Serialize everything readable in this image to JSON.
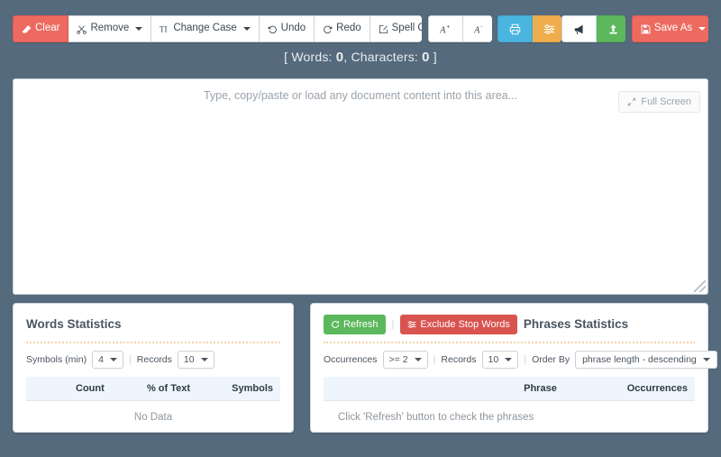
{
  "toolbar": {
    "left_groups": [
      [
        {
          "id": "clear",
          "label": "Clear",
          "icon": "eraser-icon",
          "style": "red",
          "caret": false
        },
        {
          "id": "remove",
          "label": "Remove",
          "icon": "scissors-icon",
          "style": "white",
          "caret": true
        },
        {
          "id": "change-case",
          "label": "Change Case",
          "icon": "text-case-icon",
          "style": "white",
          "caret": true
        },
        {
          "id": "undo",
          "label": "Undo",
          "icon": "undo-icon",
          "style": "white",
          "caret": false
        },
        {
          "id": "redo",
          "label": "Redo",
          "icon": "redo-icon",
          "style": "white",
          "caret": false
        },
        {
          "id": "spell-check",
          "label": "Spell Check",
          "icon": "pencil-square-icon",
          "style": "white",
          "caret": false
        }
      ],
      [
        {
          "id": "font-increase",
          "label": "A",
          "sup": "+",
          "icon": "font-increase-icon",
          "style": "white",
          "caret": false
        },
        {
          "id": "font-decrease",
          "label": "A",
          "sup": "-",
          "icon": "font-decrease-icon",
          "style": "white",
          "caret": false
        }
      ],
      [
        {
          "id": "print",
          "label": "",
          "icon": "print-icon",
          "style": "blue",
          "caret": false
        },
        {
          "id": "format",
          "label": "",
          "icon": "sliders-icon",
          "style": "orange",
          "caret": false
        }
      ]
    ],
    "right_groups": [
      [
        {
          "id": "announce",
          "label": "",
          "icon": "megaphone-icon",
          "style": "white",
          "caret": false
        },
        {
          "id": "upload",
          "label": "",
          "icon": "upload-icon",
          "style": "green",
          "caret": false
        }
      ],
      [
        {
          "id": "save-as",
          "label": "Save As",
          "icon": "save-icon",
          "style": "red",
          "caret": true
        }
      ]
    ]
  },
  "counter": {
    "open_bracket": "[ ",
    "words_label": "Words: ",
    "words_value": "0",
    "mid": ", ",
    "characters_label": "Characters: ",
    "characters_value": "0",
    "close_bracket": " ]"
  },
  "editor": {
    "placeholder": "Type, copy/paste or load any document content into this area...",
    "value": "",
    "fullscreen_label": "Full Screen",
    "fullscreen_icon": "expand-arrows-icon"
  },
  "words_panel": {
    "title": "Words Statistics",
    "controls": {
      "symbols_label": "Symbols (min)",
      "symbols_value": "4",
      "separator": "|",
      "records_label": "Records",
      "records_value": "10"
    },
    "table": {
      "columns": [
        "",
        "Count",
        "% of Text",
        "Symbols"
      ],
      "rows": [],
      "empty_message": "No Data"
    }
  },
  "phrases_panel": {
    "title": "Phrases Statistics",
    "refresh_label": "Refresh",
    "refresh_icon": "refresh-icon",
    "exclude_label": "Exclude Stop Words",
    "exclude_icon": "filter-icon",
    "separator": "|",
    "controls": {
      "occurrences_label": "Occurrences",
      "occurrences_value": ">= 2",
      "records_label": "Records",
      "records_value": "10",
      "order_by_label": "Order By",
      "order_by_value": "phrase length - descending"
    },
    "table": {
      "columns": [
        "",
        "Phrase",
        "Occurrences"
      ],
      "rows": [],
      "empty_message": "Click 'Refresh' button to check the phrases"
    }
  },
  "colors": {
    "background": "#556a7d",
    "danger": "#ec6a5f",
    "success": "#5cb85c",
    "info": "#4ab5de",
    "warning": "#f0ad4e",
    "divider": "#f6d3ae",
    "table_header": "#eff5fd"
  }
}
